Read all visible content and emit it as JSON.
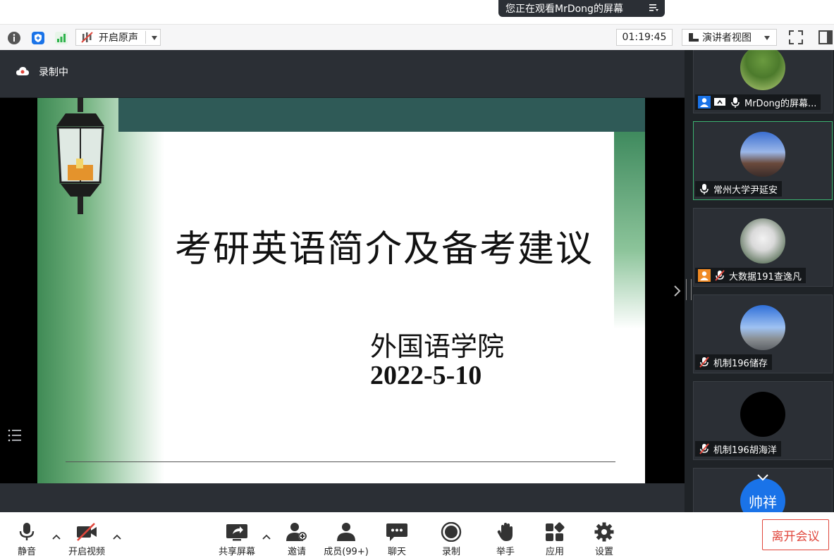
{
  "banner": {
    "text": "您正在观看MrDong的屏幕"
  },
  "topbar": {
    "audio_label": "开启原声",
    "timer": "01:19:45",
    "view_label": "演讲者视图"
  },
  "recording": {
    "label": "录制中"
  },
  "slide": {
    "title": "考研英语简介及备考建议",
    "subtitle1": "外国语学院",
    "subtitle2": "2022-5-10"
  },
  "participants": [
    {
      "name": "MrDong的屏幕..."
    },
    {
      "name": "常州大学尹延安"
    },
    {
      "name": "大数据191查逸凡"
    },
    {
      "name": "机制196储存"
    },
    {
      "name": "机制196胡海洋"
    },
    {
      "name": "帅祥"
    }
  ],
  "toolbar": {
    "mute": "静音",
    "video": "开启视频",
    "share": "共享屏幕",
    "invite": "邀请",
    "members": "成员(99+)",
    "chat": "聊天",
    "record": "录制",
    "raise": "举手",
    "apps": "应用",
    "settings": "设置",
    "leave": "离开会议"
  },
  "colors": {
    "accent_red": "#e0463b",
    "green_border": "#3cb371",
    "blue": "#1a73e8"
  }
}
